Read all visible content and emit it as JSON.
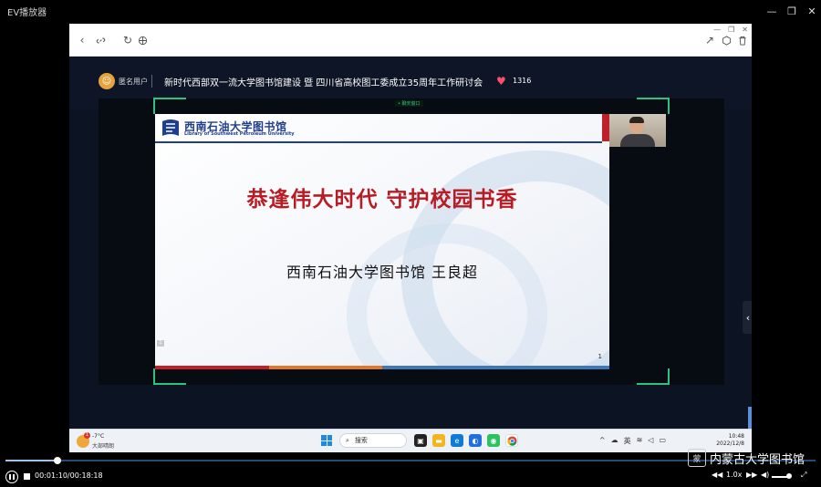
{
  "player": {
    "title": "EV播放器",
    "current_time": "00:01:10",
    "total_time": "00:18:18",
    "time_display": "00:01:10/00:18:18",
    "progress": 0.064,
    "speed": "1.0x",
    "volume": 0.8,
    "watermark": "内蒙古大学图书馆"
  },
  "live": {
    "user_label": "匿名用户",
    "title": "新时代西部双一流大学图书馆建设 暨 四川省高校图工委成立35周年工作研讨会",
    "like_count": "1316",
    "top_badge": "• 聊天窗口"
  },
  "slide": {
    "logo_cn": "西南石油大学图书馆",
    "logo_en": "Library of Southwest Petroleum University",
    "main_title": "恭逢伟大时代 守护校园书香",
    "subtitle": "西南石油大学图书馆  王良超",
    "page_number": "1",
    "mini_badge": "1",
    "bottom_colors": [
      "#c0202a",
      "#e0782b",
      "#3f78b5",
      "#3f78b5"
    ]
  },
  "taskbar": {
    "temp": "-7°C",
    "weather_desc": "大部晴朗",
    "weather_badge": "1",
    "search_label": "搜索",
    "input_method": "英",
    "time": "10:48",
    "date": "2022/12/8"
  },
  "icons": {
    "back": "chevron-left-icon",
    "link": "link-icon",
    "refresh": "refresh-icon",
    "globe": "globe-icon",
    "share": "share-icon",
    "cube": "cube-icon",
    "trash": "trash-icon"
  }
}
